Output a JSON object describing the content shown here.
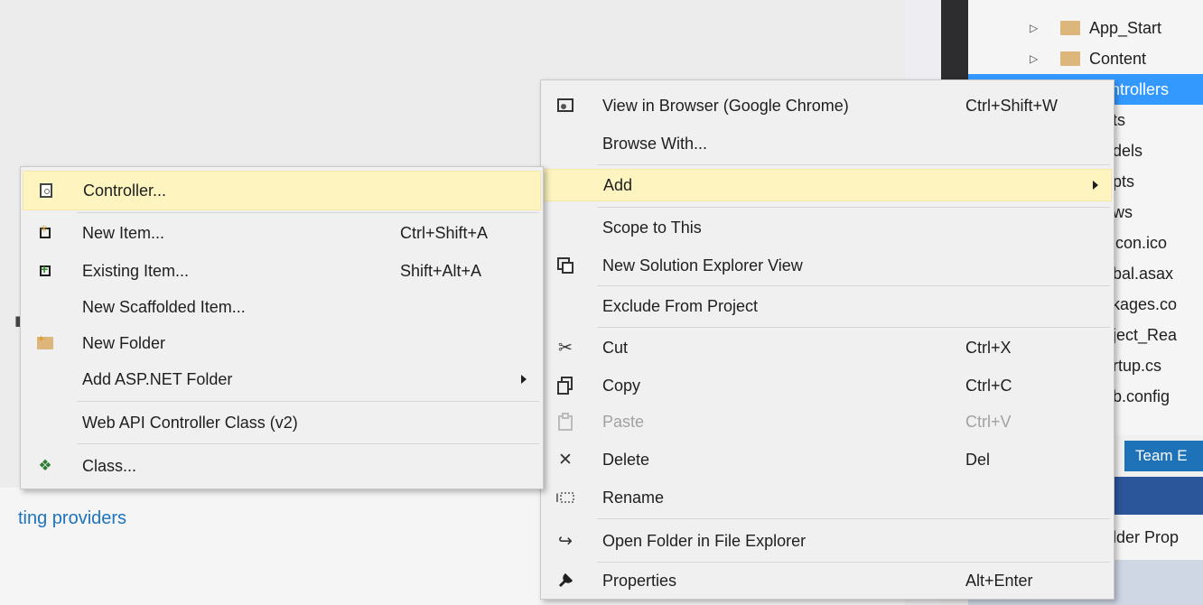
{
  "background": {
    "partial_link": "ting providers"
  },
  "solution_explorer": {
    "items": [
      {
        "label": "App_Start",
        "expandable": true
      },
      {
        "label": "Content",
        "expandable": true
      },
      {
        "label": "ontrollers",
        "selected": true
      },
      {
        "label": "nts"
      },
      {
        "label": "odels"
      },
      {
        "label": "ripts"
      },
      {
        "label": "ews"
      },
      {
        "label": "vicon.ico"
      },
      {
        "label": "obal.asax"
      },
      {
        "label": "ckages.co"
      },
      {
        "label": "oject_Rea"
      },
      {
        "label": "artup.cs"
      },
      {
        "label": "eb.config"
      }
    ],
    "team_tab": "Team E",
    "props_label": "older Prop"
  },
  "context_menu": {
    "items": [
      {
        "label": "View in Browser (Google Chrome)",
        "shortcut": "Ctrl+Shift+W",
        "icon": "browser-icon"
      },
      {
        "label": "Browse With...",
        "shortcut": ""
      },
      {
        "label": "Add",
        "shortcut": "",
        "submenu": true,
        "highlighted": true
      },
      {
        "label": "Scope to This",
        "shortcut": ""
      },
      {
        "label": "New Solution Explorer View",
        "shortcut": "",
        "icon": "solution-view-icon"
      },
      {
        "label": "Exclude From Project",
        "shortcut": ""
      },
      {
        "label": "Cut",
        "shortcut": "Ctrl+X",
        "icon": "cut-icon"
      },
      {
        "label": "Copy",
        "shortcut": "Ctrl+C",
        "icon": "copy-icon"
      },
      {
        "label": "Paste",
        "shortcut": "Ctrl+V",
        "icon": "paste-icon",
        "disabled": true
      },
      {
        "label": "Delete",
        "shortcut": "Del",
        "icon": "delete-icon"
      },
      {
        "label": "Rename",
        "shortcut": "",
        "icon": "rename-icon"
      },
      {
        "label": "Open Folder in File Explorer",
        "shortcut": "",
        "icon": "open-folder-icon"
      },
      {
        "label": "Properties",
        "shortcut": "Alt+Enter",
        "icon": "wrench-icon"
      }
    ]
  },
  "add_submenu": {
    "items": [
      {
        "label": "Controller...",
        "shortcut": "",
        "highlighted": true,
        "icon": "controller-icon"
      },
      {
        "label": "New Item...",
        "shortcut": "Ctrl+Shift+A",
        "icon": "new-item-icon"
      },
      {
        "label": "Existing Item...",
        "shortcut": "Shift+Alt+A",
        "icon": "existing-item-icon"
      },
      {
        "label": "New Scaffolded Item...",
        "shortcut": ""
      },
      {
        "label": "New Folder",
        "shortcut": "",
        "icon": "new-folder-icon"
      },
      {
        "label": "Add ASP.NET Folder",
        "shortcut": "",
        "submenu": true
      },
      {
        "label": "Web API Controller Class (v2)",
        "shortcut": ""
      },
      {
        "label": "Class...",
        "shortcut": "",
        "icon": "class-icon"
      }
    ]
  },
  "colors": {
    "highlight": "#fdf4bf",
    "selection": "#3399ff",
    "link": "#1e73be",
    "team_tab": "#1e72b8"
  }
}
